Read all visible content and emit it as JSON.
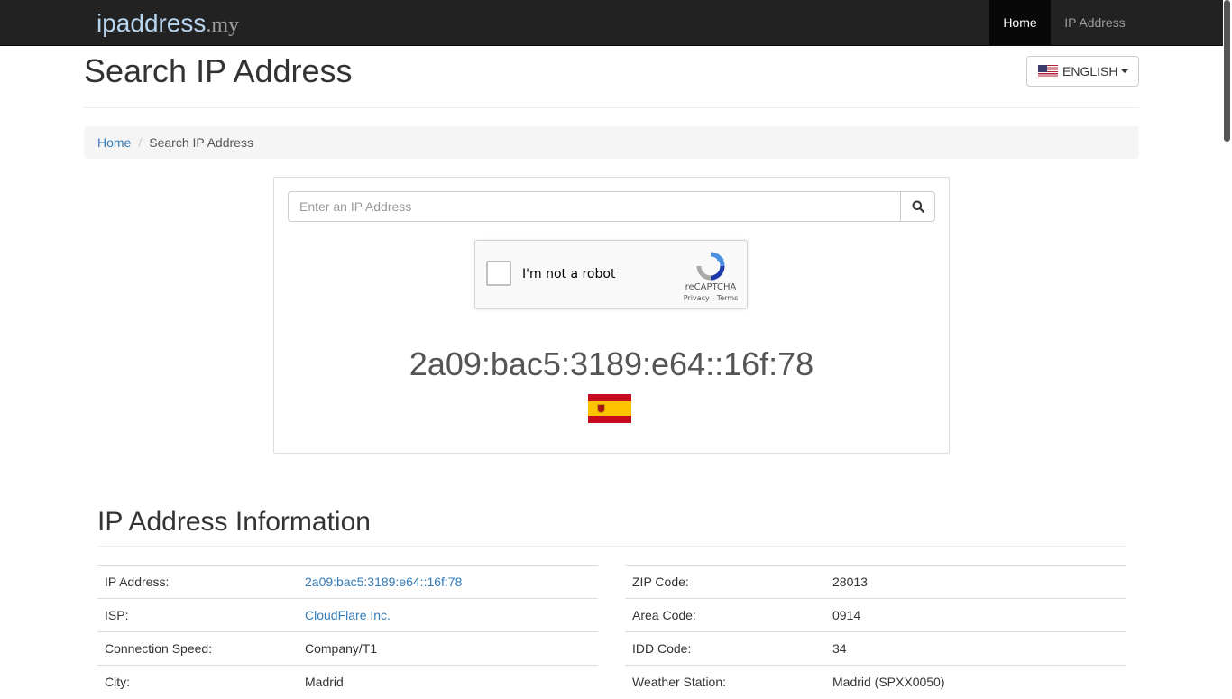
{
  "navbar": {
    "brand_main": "ipaddress",
    "brand_tld": ".my",
    "links": [
      {
        "label": "Home",
        "active": true
      },
      {
        "label": "IP Address",
        "active": false
      }
    ]
  },
  "header": {
    "title": "Search IP Address",
    "language_button": "ENGLISH"
  },
  "breadcrumb": {
    "home": "Home",
    "current": "Search IP Address"
  },
  "search": {
    "placeholder": "Enter an IP Address",
    "button_icon": "search-icon"
  },
  "recaptcha": {
    "label": "I'm not a robot",
    "brand": "reCAPTCHA",
    "privacy": "Privacy",
    "terms": "Terms"
  },
  "result": {
    "ip": "2a09:bac5:3189:e64::16f:78",
    "country_flag": "spain-flag"
  },
  "info": {
    "title": "IP Address Information",
    "left": [
      {
        "label": "IP Address:",
        "value": "2a09:bac5:3189:e64::16f:78"
      },
      {
        "label": "ISP:",
        "value": "CloudFlare Inc."
      },
      {
        "label": "Connection Speed:",
        "value": "Company/T1"
      },
      {
        "label": "City:",
        "value": "Madrid"
      }
    ],
    "right": [
      {
        "label": "ZIP Code:",
        "value": "28013"
      },
      {
        "label": "Area Code:",
        "value": "0914"
      },
      {
        "label": "IDD Code:",
        "value": "34"
      },
      {
        "label": "Weather Station:",
        "value": "Madrid (SPXX0050)"
      }
    ]
  },
  "colors": {
    "navbar_bg": "#222222",
    "link": "#337ab7",
    "text": "#333333"
  }
}
